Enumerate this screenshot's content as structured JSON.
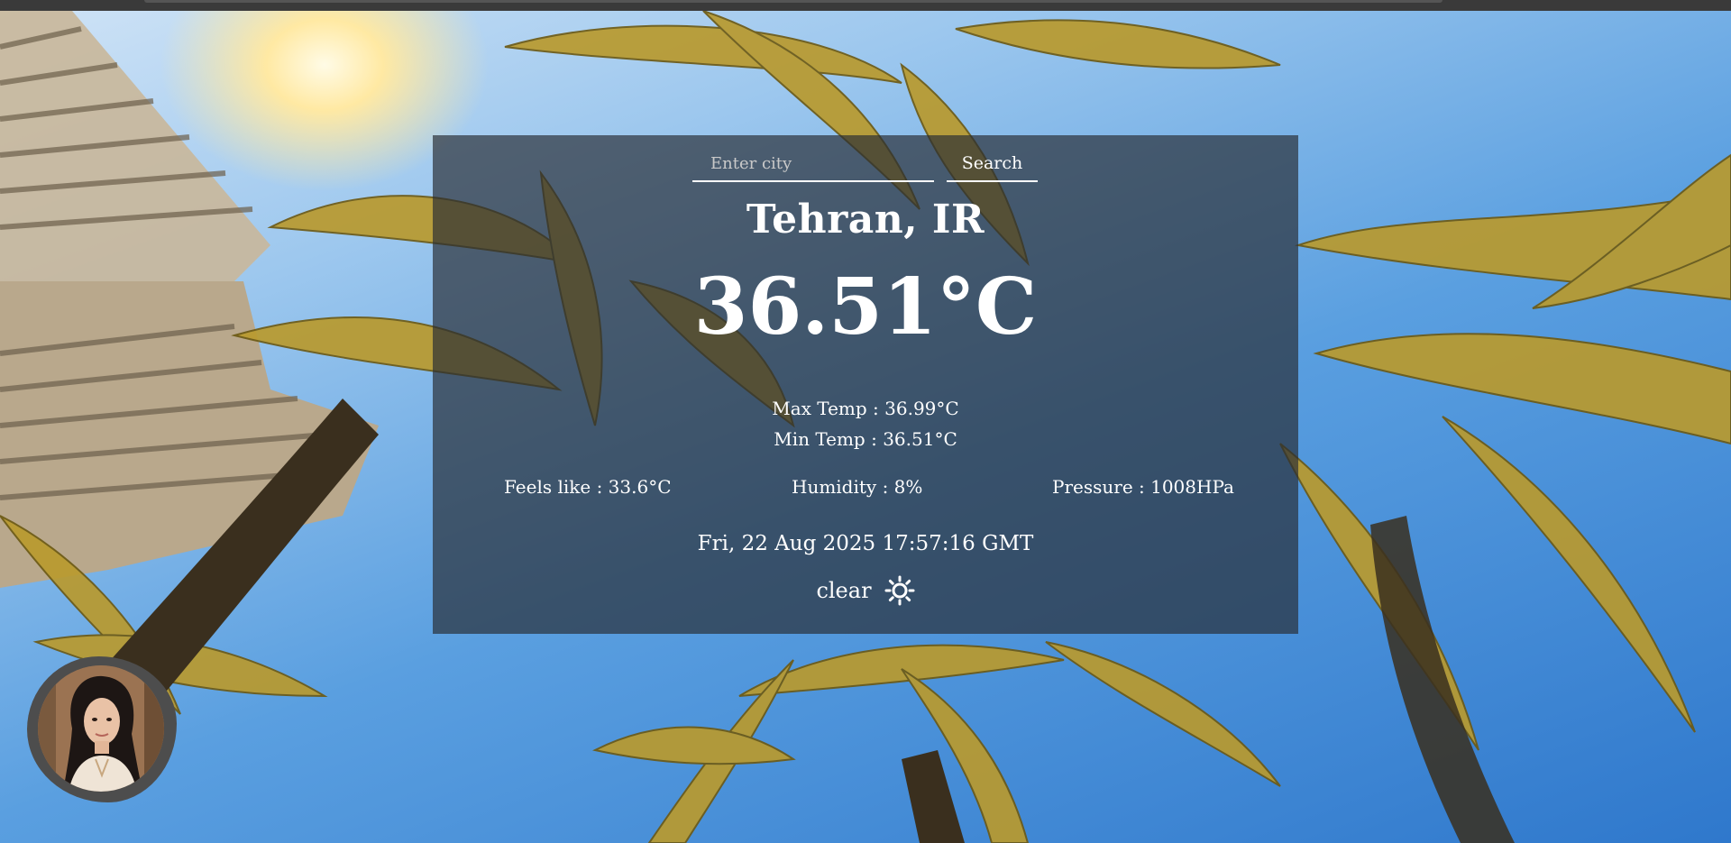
{
  "search": {
    "placeholder": "Enter city",
    "button_label": "Search"
  },
  "weather": {
    "city": "Tehran, IR",
    "temperature": "36.51°C",
    "max_temp": "Max Temp : 36.99°C",
    "min_temp": "Min Temp : 36.51°C",
    "feels_like": "Feels like : 33.6°C",
    "humidity": "Humidity : 8%",
    "pressure": "Pressure : 1008HPa",
    "datetime": "Fri, 22 Aug 2025 17:57:16 GMT",
    "condition": "clear",
    "condition_icon": "sun-icon"
  },
  "profile": {
    "avatar_icon": "user-avatar"
  },
  "colors": {
    "card_overlay": "#282c34",
    "text": "#ffffff",
    "sky": "#2f78cc",
    "palm": "#c9a83a"
  }
}
